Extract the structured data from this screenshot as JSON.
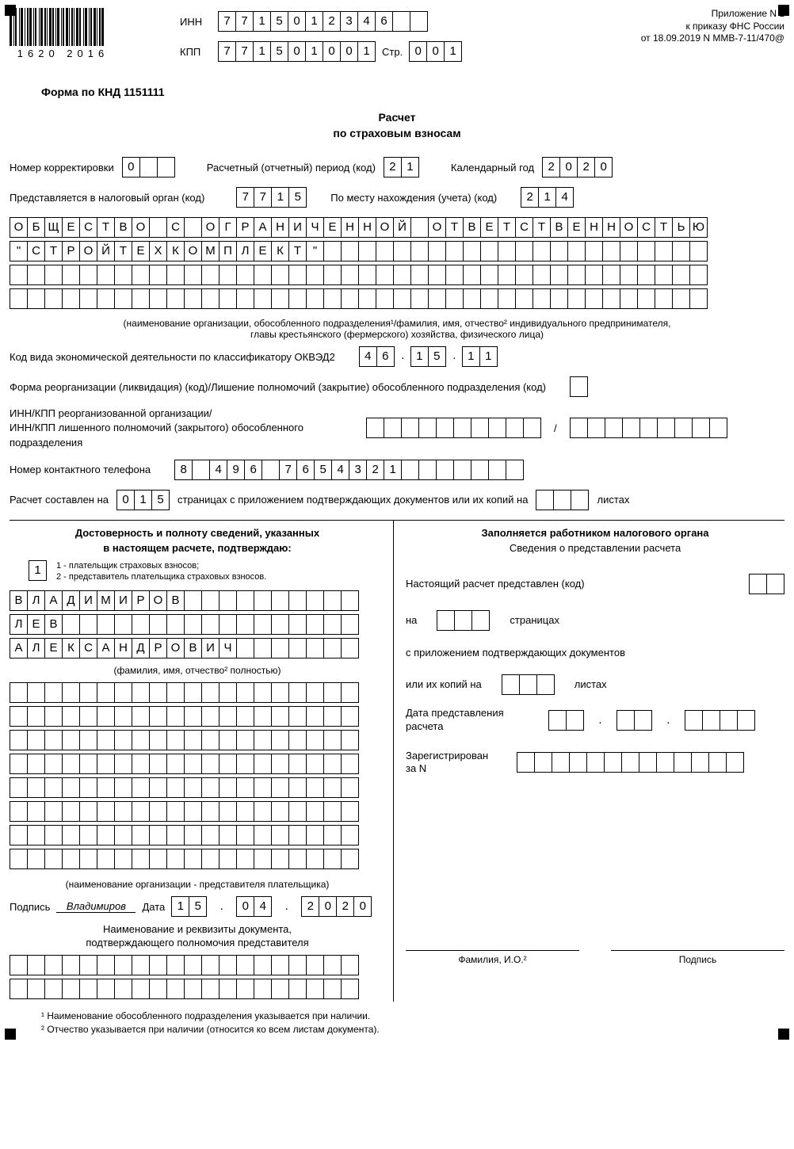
{
  "barcode": "1620  2016",
  "inn_lbl": "ИНН",
  "inn": "7715012346",
  "kpp_lbl": "КПП",
  "kpp": "771501001",
  "str_lbl": "Стр.",
  "str": "001",
  "annex": {
    "l1": "Приложение N 1",
    "l2": "к приказу ФНС России",
    "l3": "от 18.09.2019 N ММВ-7-11/470@"
  },
  "form": "Форма по КНД 1151111",
  "title1": "Расчет",
  "title2": "по страховым взносам",
  "r1": {
    "a": "Номер корректировки",
    "av": "0",
    "b": "Расчетный (отчетный) период (код)",
    "bv": "21",
    "c": "Календарный год",
    "cv": "2020"
  },
  "r2": {
    "a": "Представляется в налоговый орган (код)",
    "av": "7715",
    "b": "По месту нахождения (учета) (код)",
    "bv": "214"
  },
  "org1": "ОБЩЕСТВО С ОГРАНИЧЕННОЙ ОТВЕТСТВЕННОСТЬЮ",
  "org2": "\"СТРОЙТЕХКОМПЛЕКТ\"",
  "orgnote": "(наименование организации, обособленного подразделения¹/фамилия, имя, отчество² индивидуального предпринимателя,\nглавы крестьянского (фермерского) хозяйства, физического лица)",
  "okved_lbl": "Код вида экономической деятельности по классификатору ОКВЭД2",
  "okved": "46.15.11",
  "reorg_lbl": "Форма реорганизации (ликвидация) (код)/Лишение полномочий (закрытие) обособленного подразделения (код)",
  "innkpp_lbl": "ИНН/КПП реорганизованной организации/\nИНН/КПП лишенного полномочий (закрытого) обособленного подразделения",
  "phone_lbl": "Номер контактного телефона",
  "phone": "8 496 7654321",
  "pages": {
    "a": "Расчет составлен на",
    "v": "015",
    "b": "страницах с приложением подтверждающих документов или их копий на",
    "c": "листах"
  },
  "left": {
    "h1": "Достоверность и полноту сведений, указанных",
    "h2": "в настоящем расчете, подтверждаю:",
    "code": "1",
    "n1": "1 - плательщик страховых взносов;",
    "n2": "2 - представитель плательщика страховых взносов.",
    "f": "ВЛАДИМИРОВ",
    "i": "ЛЕВ",
    "o": "АЛЕКСАНДРОВИЧ",
    "fio": "(фамилия, имя, отчество² полностью)",
    "repnote": "(наименование организации - представителя плательщика)",
    "sig": "Подпись",
    "sigv": "Владимиров",
    "date": "Дата",
    "d": "15",
    "m": "04",
    "y": "2020",
    "doc1": "Наименование и реквизиты документа,",
    "doc2": "подтверждающего полномочия представителя"
  },
  "right": {
    "h": "Заполняется работником налогового органа",
    "sub": "Сведения о представлении расчета",
    "a": "Настоящий расчет представлен (код)",
    "b": "на",
    "c": "страницах",
    "d": "с приложением подтверждающих документов",
    "e": "или их копий на",
    "f": "листах",
    "g": "Дата представления расчета",
    "h2": "Зарегистрирован за N",
    "fio": "Фамилия, И.О.²",
    "sig": "Подпись"
  },
  "fn1": "¹ Наименование обособленного подразделения указывается при наличии.",
  "fn2": "² Отчество указывается при наличии (относится ко всем листам документа)."
}
